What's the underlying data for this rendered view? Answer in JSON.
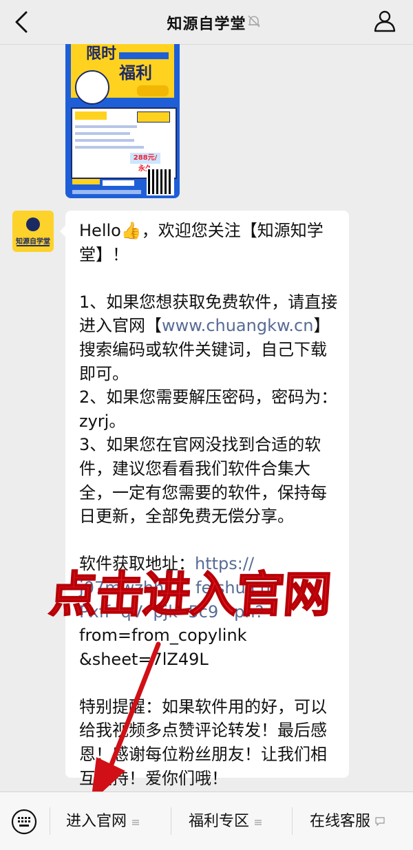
{
  "header": {
    "title": "知源自学堂",
    "back_icon": "chevron-left-icon",
    "mute_icon": "bell-muted-icon",
    "profile_icon": "person-icon"
  },
  "poster": {
    "title_top": "限时",
    "title_main": "福利",
    "price": "288元/永久"
  },
  "avatar": {
    "name": "知源自学堂"
  },
  "message": {
    "greeting": "Hello👍，欢迎您关注【知源知学堂】！",
    "p1_before": "1、如果您想获取免费软件，请直接进入官网【",
    "p1_link": "www.chuangkw.cn",
    "p1_after": "】搜索编码或软件关键词，自己下载即可。",
    "p2": "2、如果您需要解压密码，密码为：zyrj。",
    "p3": "3、如果您在官网没找到合适的软件，建议您看看我们软件合集大全，一定有您需要的软件，保持每日更新，全部免费无偿分享。",
    "addr_label": "软件获取地址：",
    "addr_link_1": "https://",
    "addr_link_2": "j07mwzhh",
    "addr_link_3": "feishu.cn/",
    "addr_link_4": "Pxff",
    "addr_link_5": "qV",
    "addr_link_6": "pjk",
    "addr_link_7": "5c9",
    "addr_link_8": "pn?",
    "addr_tail_1": "from=from_copylink",
    "addr_tail_2": "&sheet=7lZ49L",
    "reminder": "特别提醒：如果软件用的好，可以给我视频多点赞评论转发！最后感恩！感谢每位粉丝朋友！让我们相互支持！爱你们哦！"
  },
  "overlay": {
    "text": "点击进入官网",
    "color": "#e8141b"
  },
  "bottom_menu": {
    "keyboard_icon": "keyboard-icon",
    "items": [
      {
        "label": "进入官网",
        "icon": "menu-lines-icon"
      },
      {
        "label": "福利专区",
        "icon": "menu-lines-icon"
      },
      {
        "label": "在线客服",
        "icon": "chat-bubble-icon"
      }
    ]
  },
  "colors": {
    "link": "#576b95",
    "bubble": "#ffffff",
    "background": "#ededed"
  }
}
